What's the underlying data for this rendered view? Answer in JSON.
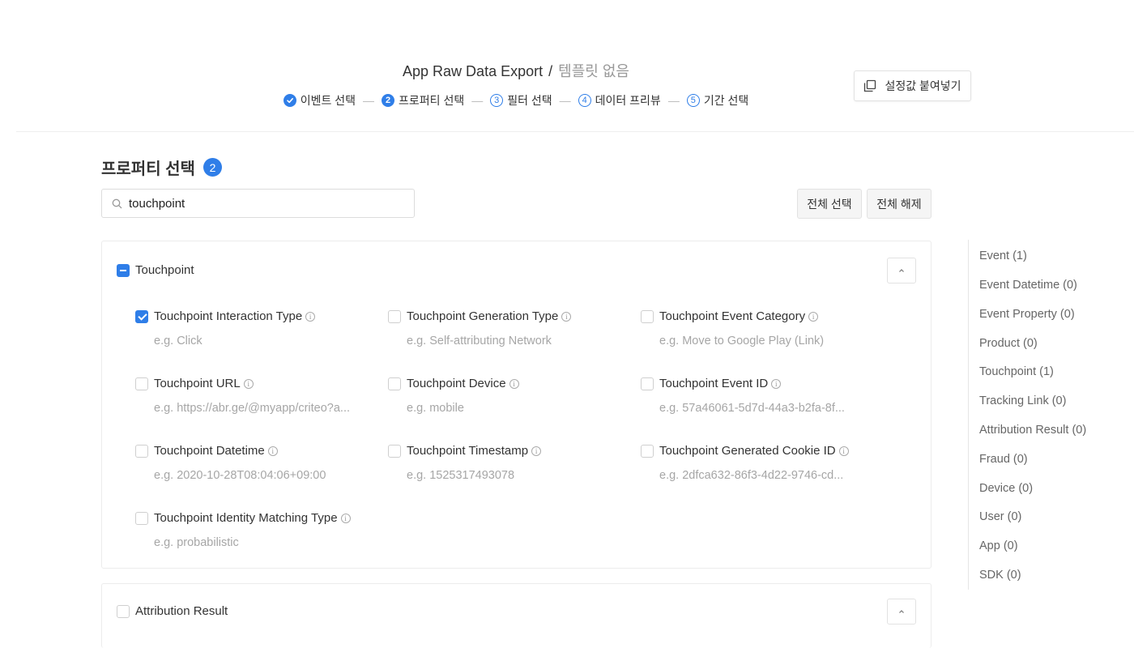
{
  "header": {
    "title": "App Raw Data Export",
    "separator": "/",
    "template": "템플릿 없음",
    "paste_label": "설정값 붙여넣기"
  },
  "steps": [
    {
      "num": "✓",
      "label": "이벤트 선택",
      "state": "done"
    },
    {
      "num": "2",
      "label": "프로퍼티 선택",
      "state": "active"
    },
    {
      "num": "3",
      "label": "필터 선택",
      "state": "todo"
    },
    {
      "num": "4",
      "label": "데이터 프리뷰",
      "state": "todo"
    },
    {
      "num": "5",
      "label": "기간 선택",
      "state": "todo"
    }
  ],
  "step_separator": "—",
  "section": {
    "title": "프로퍼티 선택",
    "badge": "2"
  },
  "search": {
    "value": "touchpoint",
    "placeholder": ""
  },
  "buttons": {
    "select_all": "전체 선택",
    "deselect_all": "전체 해제"
  },
  "groups": [
    {
      "name": "Touchpoint",
      "state": "indeterminate",
      "properties": [
        {
          "label": "Touchpoint Interaction Type",
          "example": "e.g. Click",
          "checked": true
        },
        {
          "label": "Touchpoint Generation Type",
          "example": "e.g. Self-attributing Network",
          "checked": false
        },
        {
          "label": "Touchpoint Event Category",
          "example": "e.g. Move to Google Play (Link)",
          "checked": false
        },
        {
          "label": "Touchpoint URL",
          "example": "e.g. https://abr.ge/@myapp/criteo?a...",
          "checked": false
        },
        {
          "label": "Touchpoint Device",
          "example": "e.g. mobile",
          "checked": false
        },
        {
          "label": "Touchpoint Event ID",
          "example": "e.g. 57a46061-5d7d-44a3-b2fa-8f...",
          "checked": false
        },
        {
          "label": "Touchpoint Datetime",
          "example": "e.g. 2020-10-28T08:04:06+09:00",
          "checked": false
        },
        {
          "label": "Touchpoint Timestamp",
          "example": "e.g. 1525317493078",
          "checked": false
        },
        {
          "label": "Touchpoint Generated Cookie ID",
          "example": "e.g. 2dfca632-86f3-4d22-9746-cd...",
          "checked": false
        },
        {
          "label": "Touchpoint Identity Matching Type",
          "example": "e.g. probabilistic",
          "checked": false
        }
      ]
    },
    {
      "name": "Attribution Result",
      "state": "unchecked",
      "properties": []
    }
  ],
  "info_glyph": "i",
  "sidenav": [
    "Event (1)",
    "Event Datetime (0)",
    "Event Property (0)",
    "Product (0)",
    "Touchpoint (1)",
    "Tracking Link (0)",
    "Attribution Result (0)",
    "Fraud (0)",
    "Device (0)",
    "User (0)",
    "App (0)",
    "SDK (0)"
  ],
  "colors": {
    "accent": "#2f7ee8",
    "muted": "#a6a6a6",
    "text": "#333333"
  },
  "icons": {
    "paste": "copy-icon",
    "search": "search-icon",
    "collapse": "chevron-up-icon",
    "info": "info-icon"
  }
}
